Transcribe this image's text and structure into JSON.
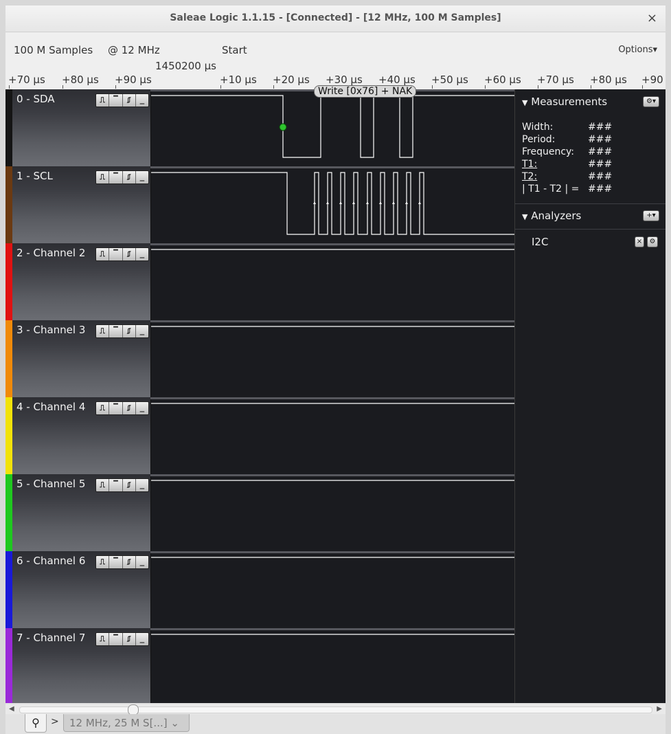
{
  "window": {
    "title": "Saleae Logic 1.1.15 - [Connected] - [12 MHz, 100 M Samples]",
    "close_glyph": "×"
  },
  "infobar": {
    "samples": "100 M Samples",
    "rate": "@  12 MHz",
    "start": "Start",
    "position": "1450200 µs",
    "options": "Options▾"
  },
  "ruler": {
    "ticks": [
      "+70 µs",
      "+80 µs",
      "+90 µs",
      "+10 µs",
      "+20 µs",
      "+30 µs",
      "+40 µs",
      "+50 µs",
      "+60 µs",
      "+70 µs",
      "+80 µs",
      "+90"
    ]
  },
  "channels": [
    {
      "label": "0 - SDA",
      "color": "#151515"
    },
    {
      "label": "1 - SCL",
      "color": "#6b3a12"
    },
    {
      "label": "2 - Channel 2",
      "color": "#e01212"
    },
    {
      "label": "3 - Channel 3",
      "color": "#f08a0a"
    },
    {
      "label": "4 - Channel 4",
      "color": "#f2e20a"
    },
    {
      "label": "5 - Channel 5",
      "color": "#1fc81f"
    },
    {
      "label": "6 - Channel 6",
      "color": "#1a1ad8"
    },
    {
      "label": "7 - Channel 7",
      "color": "#9a2ad8"
    }
  ],
  "trigger_glyphs": [
    "⎍",
    "▔",
    "⎎",
    "_"
  ],
  "decode": {
    "text": "Write [0x76] + NAK"
  },
  "sidebar": {
    "measurements_title": "Measurements",
    "measurements_icon": "gear-icon",
    "measurements": [
      {
        "label": "Width:",
        "value": "###"
      },
      {
        "label": "Period:",
        "value": "###"
      },
      {
        "label": "Frequency:",
        "value": "###"
      },
      {
        "label": "T1:",
        "value": "###"
      },
      {
        "label": "T2:",
        "value": "###"
      },
      {
        "label": "| T1 - T2 | =",
        "value": "###"
      }
    ],
    "analyzers_title": "Analyzers",
    "analyzers_icon": "add-icon",
    "analyzers": [
      {
        "name": "I2C"
      }
    ]
  },
  "bottom": {
    "session_tab": "12 MHz, 25 M S[...]  ⌄",
    "more_glyph": ">",
    "search_icon": "search-icon"
  },
  "colors": {
    "background": "#1a1b1f",
    "signal": "#ffffff",
    "marker": "#2ec42e"
  }
}
